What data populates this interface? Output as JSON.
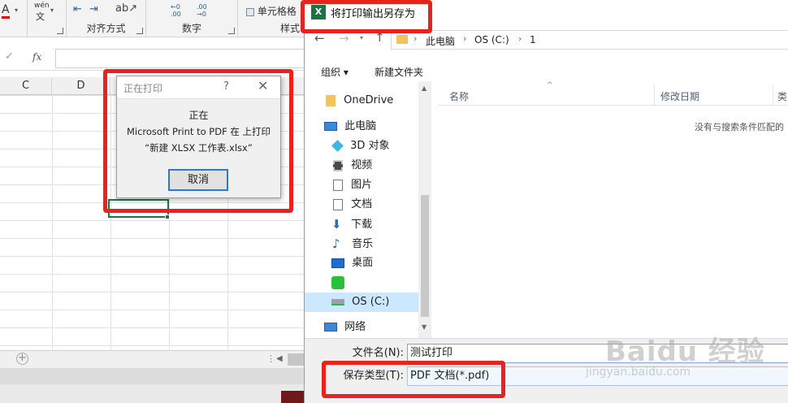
{
  "ribbon": {
    "font_a": "A",
    "wen_top": "wén",
    "wen_char": "文",
    "align_label": "对齐方式",
    "number_label": "数字",
    "dec_inc": "←0 .00",
    "dec_dec": ".00 →0",
    "cell_format": "单元格格",
    "style_label": "样式"
  },
  "formula": {
    "fx": "fx"
  },
  "columns": [
    "C",
    "D"
  ],
  "print_dialog": {
    "title": "正在打印",
    "help": "?",
    "line1": "正在",
    "line2": "Microsoft Print to PDF 在  上打印",
    "line3": "“新建 XLSX 工作表.xlsx”",
    "cancel": "取消"
  },
  "save_dialog": {
    "title": "将打印输出另存为",
    "breadcrumb": [
      "此电脑",
      "OS (C:)",
      "1"
    ],
    "organize": "组织 ▾",
    "new_folder": "新建文件夹",
    "nav_items": [
      "OneDrive",
      "此电脑",
      "3D 对象",
      "视频",
      "图片",
      "文档",
      "下载",
      "音乐",
      "桌面",
      "",
      "OS (C:)",
      "网络"
    ],
    "col_name": "名称",
    "col_date": "修改日期",
    "col_type": "类",
    "empty_msg": "没有与搜索条件匹配的",
    "filename_label": "文件名(N):",
    "filename_value": "测试打印",
    "filetype_label": "保存类型(T):",
    "filetype_value": "PDF 文档(*.pdf)"
  },
  "watermark": {
    "brand": "Baidu 经验",
    "url": "jingyan.baidu.com"
  }
}
